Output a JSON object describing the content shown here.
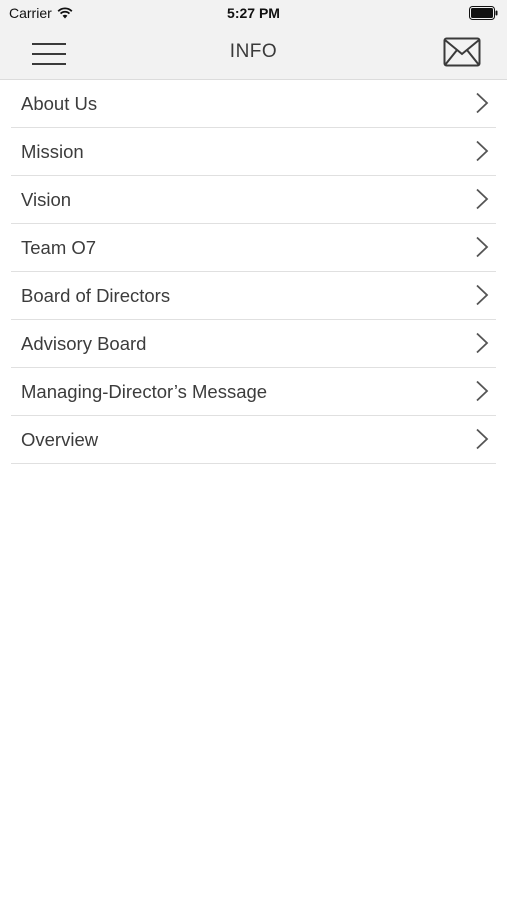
{
  "status_bar": {
    "carrier": "Carrier",
    "time": "5:27 PM",
    "wifi_icon": "wifi-icon",
    "battery_icon": "battery-icon"
  },
  "nav": {
    "title": "INFO",
    "menu_icon": "hamburger-menu-icon",
    "mail_icon": "mail-icon"
  },
  "menu_items": [
    {
      "label": "About Us"
    },
    {
      "label": "Mission"
    },
    {
      "label": "Vision"
    },
    {
      "label": "Team O7"
    },
    {
      "label": "Board of Directors"
    },
    {
      "label": "Advisory Board"
    },
    {
      "label": "Managing-Director’s Message"
    },
    {
      "label": "Overview"
    }
  ],
  "colors": {
    "bar_background": "#f2f2f2",
    "text": "#3a3a3a",
    "divider": "#e0e0e0"
  }
}
